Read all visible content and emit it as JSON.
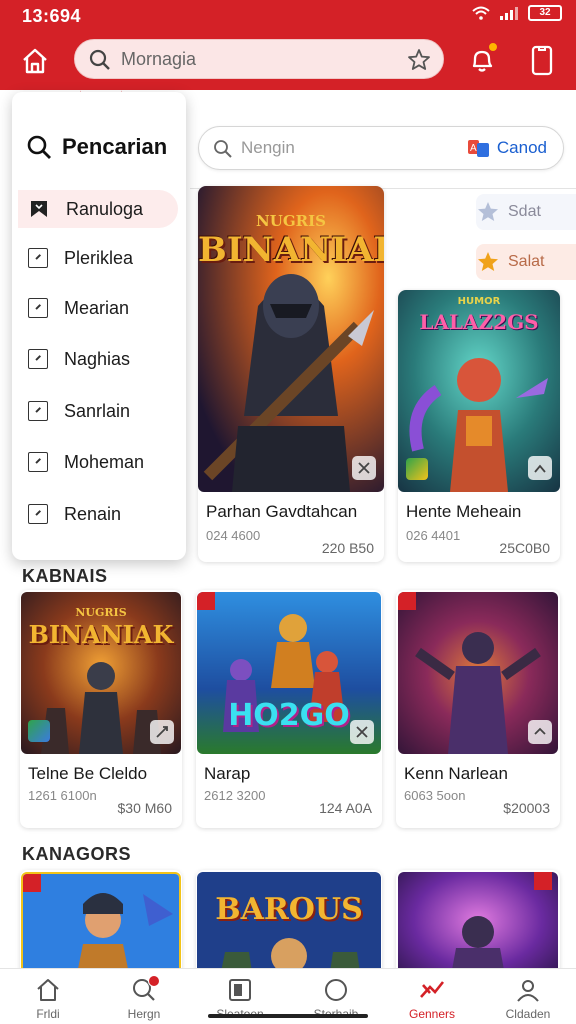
{
  "status": {
    "time": "13:694",
    "battery": "32"
  },
  "header": {
    "search_placeholder": "Mornagia"
  },
  "search_bar": {
    "placeholder": "Nengin",
    "cancel_label": "Canod"
  },
  "filters": {
    "saved_label": "Sdat",
    "starred_label": "Salat"
  },
  "drawer": {
    "title": "Pencarian",
    "items": [
      {
        "label": "Ranuloga",
        "active": true
      },
      {
        "label": "Pleriklea"
      },
      {
        "label": "Mearian"
      },
      {
        "label": "Naghias"
      },
      {
        "label": "Sanrlain"
      },
      {
        "label": "Moheman"
      },
      {
        "label": "Renain"
      }
    ]
  },
  "featured": [
    {
      "art_title": "BINANIAK",
      "art_subtitle": "NUGRIS",
      "title": "Parhan Gavdtahcan",
      "meta": "024 4600",
      "price": "220 B50"
    },
    {
      "art_title": "LALAZ2GS",
      "art_subtitle": "HUMOR",
      "title": "Hente Meheain",
      "meta": "026 4401",
      "price": "25C0B0"
    }
  ],
  "sections": [
    {
      "title": "KABNAIS",
      "cards": [
        {
          "art_title": "BINANIAK",
          "art_subtitle": "NUGRIS",
          "title": "Telne Be Cleldo",
          "meta": "1261 6100n",
          "price": "$30 M60"
        },
        {
          "art_title": "HO2GO",
          "title": "Narap",
          "meta": "2612 3200",
          "price": "124 A0A"
        },
        {
          "title": "Kenn Narlean",
          "meta": "6063 5oon",
          "price": "$20003"
        }
      ]
    },
    {
      "title": "KANAGORS",
      "cards": [
        {
          "title": ""
        },
        {
          "art_title": "BAROUS",
          "title": ""
        },
        {
          "title": ""
        }
      ]
    }
  ],
  "bottom_nav": [
    {
      "label": "Frldi",
      "icon": "home-icon"
    },
    {
      "label": "Hergn",
      "icon": "search-icon"
    },
    {
      "label": "Sleatoen",
      "icon": "library-icon"
    },
    {
      "label": "Sterhaib",
      "icon": "circle-icon"
    },
    {
      "label": "Genners",
      "icon": "games-icon",
      "active": true
    },
    {
      "label": "Cldaden",
      "icon": "profile-icon"
    }
  ],
  "colors": {
    "brand_red": "#d42127",
    "link_blue": "#1a5fd0"
  }
}
